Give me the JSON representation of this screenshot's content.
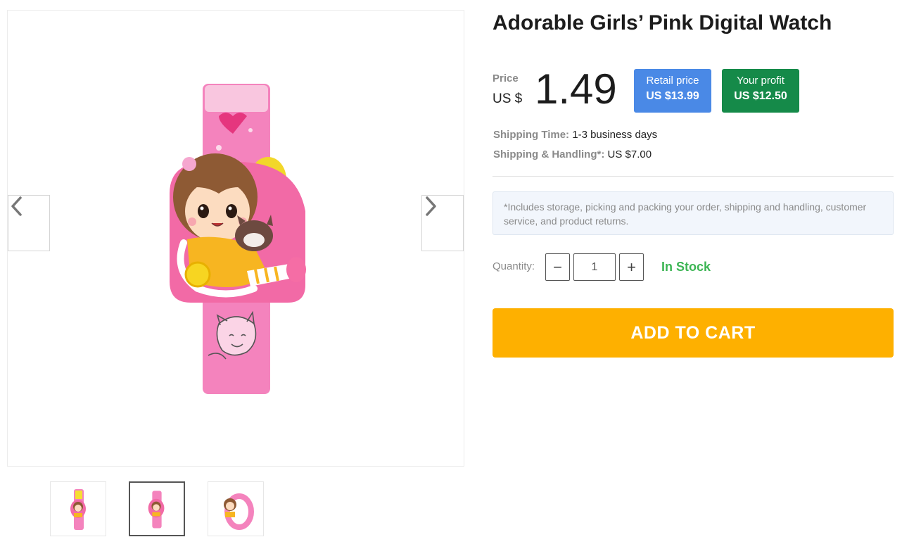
{
  "gallery": {
    "main_image_alt": "Pink kids watch with cartoon girl and cat",
    "prev_icon": "chevron-left-icon",
    "next_icon": "chevron-right-icon",
    "thumbnails": [
      {
        "alt": "Watch front view with yellow face",
        "active": false
      },
      {
        "alt": "Watch front view",
        "active": true
      },
      {
        "alt": "Watch side view",
        "active": false
      }
    ]
  },
  "product": {
    "title": "Adorable Girls’ Pink Digital Watch",
    "price_label": "Price",
    "currency": "US $",
    "price": "1.49",
    "retail_label": "Retail price",
    "retail_value": "US $13.99",
    "profit_label": "Your profit",
    "profit_value": "US $12.50",
    "shipping_time_label": "Shipping Time:",
    "shipping_time_value": "1-3 business days",
    "handling_label": "Shipping & Handling*:",
    "handling_value": "US $7.00",
    "note": "*Includes storage, picking and packing your order, shipping and handling, customer service, and product returns.",
    "quantity_label": "Quantity:",
    "quantity_value": "1",
    "minus_symbol": "−",
    "plus_symbol": "+",
    "stock_status": "In Stock",
    "add_to_cart": "ADD TO CART"
  },
  "colors": {
    "retail_badge": "#4a89e6",
    "profit_badge": "#158a49",
    "in_stock": "#3cb554",
    "cart_button": "#feb000",
    "watch_pink": "#f06aa8"
  }
}
